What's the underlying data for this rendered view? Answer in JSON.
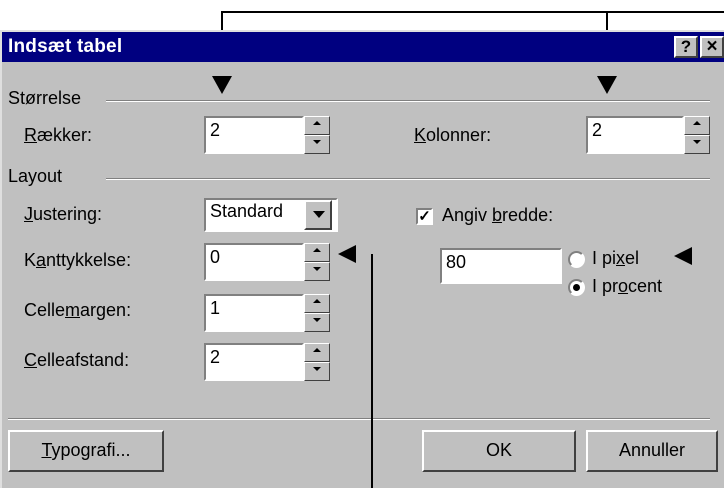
{
  "dialog": {
    "title": "Indsæt tabel",
    "help_label": "?",
    "close_label": "×"
  },
  "size_group": {
    "label": "Størrelse",
    "rows_label_u": "R",
    "rows_label_rest": "ækker:",
    "rows_value": "2",
    "cols_label_u": "K",
    "cols_label_rest": "olonner:",
    "cols_value": "2"
  },
  "layout_group": {
    "label": "Layout",
    "align_label_u": "J",
    "align_label_rest": "ustering:",
    "align_value": "Standard",
    "border_label_a": "K",
    "border_label_u": "a",
    "border_label_b": "nttykkelse:",
    "border_value": "0",
    "padding_label_a": "Celle",
    "padding_label_u": "m",
    "padding_label_b": "argen:",
    "padding_value": "1",
    "spacing_label_u": "C",
    "spacing_label_rest": "elleafstand:",
    "spacing_value": "2",
    "width_checkbox_checked": true,
    "width_label_a": "Angiv ",
    "width_label_u": "b",
    "width_label_b": "redde:",
    "width_value": "80",
    "pixel_label_a": "I pi",
    "pixel_label_u": "x",
    "pixel_label_b": "el",
    "percent_label_a": "I pr",
    "percent_label_u": "o",
    "percent_label_b": "cent",
    "selected_unit": "percent"
  },
  "buttons": {
    "style_label_u": "T",
    "style_label_rest": "ypografi...",
    "ok_label": "OK",
    "cancel_label": "Annuller"
  },
  "colors": {
    "titlebar": "#000080",
    "dialog_face": "#c0c0c0"
  }
}
